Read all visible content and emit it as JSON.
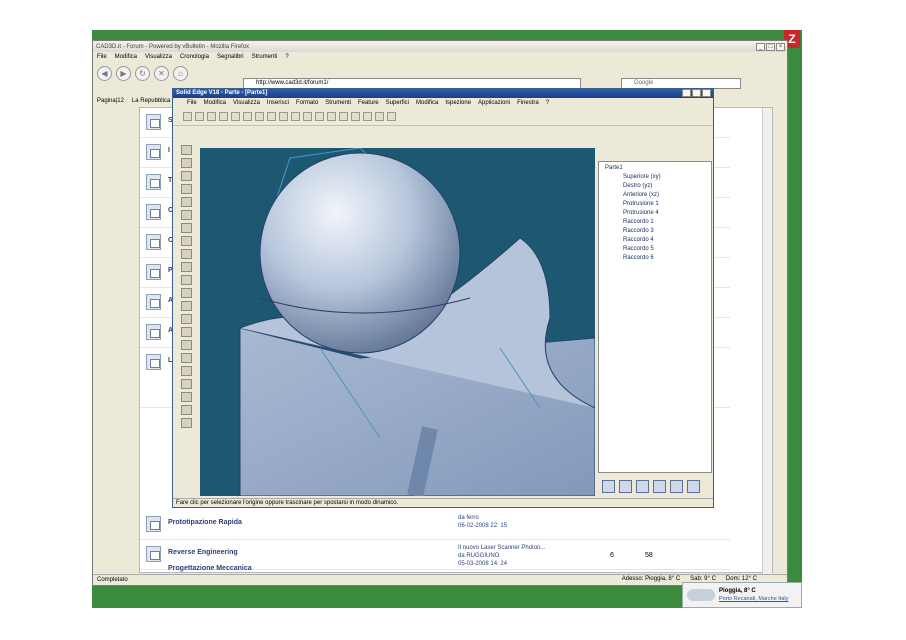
{
  "firefox": {
    "title": "CAD3D.it - Forum - Powered by vBulletin - Mozilla Firefox",
    "menu": [
      "File",
      "Modifica",
      "Visualizza",
      "Cronologia",
      "Segnalibri",
      "Strumenti",
      "?"
    ],
    "url": "http://www.cad3d.it/forum1/",
    "search_placeholder": "Google",
    "tabs": [
      "Pagina|12",
      "La Repubblica"
    ],
    "status_left": "Completato",
    "weather": [
      "Adesso: Pioggia, 8° C",
      "Sab: 9° C",
      "Dom: 12° C"
    ]
  },
  "forum": {
    "rows": [
      {
        "title": "S",
        "mid": "",
        "n1": "",
        "n2": ""
      },
      {
        "title": "I",
        "mid": "",
        "n1": "",
        "n2": ""
      },
      {
        "title": "T",
        "mid": "",
        "n1": "",
        "n2": ""
      },
      {
        "title": "C",
        "mid": "",
        "n1": "",
        "n2": ""
      },
      {
        "title": "C",
        "mid": "",
        "n1": "",
        "n2": ""
      },
      {
        "title": "P",
        "mid": "",
        "n1": "",
        "n2": ""
      },
      {
        "title": "A",
        "mid": "",
        "n1": "",
        "n2": ""
      },
      {
        "title": "A",
        "mid": "",
        "n1": "",
        "n2": ""
      },
      {
        "title": "L",
        "mid": "",
        "n1": "",
        "n2": ""
      },
      {
        "title": "Prototipazione Rapida",
        "mid": "da ferro\n06-02-2008 22: 15",
        "n1": "",
        "n2": ""
      },
      {
        "title": "Reverse Engineering",
        "mid": "Il nuovo Laser Scanner Photon...\nda RUGGIUNO\n05-03-2008 14: 24",
        "n1": "6",
        "n2": "58"
      },
      {
        "title": "Progettazione Meccanica",
        "mid": "",
        "n1": "",
        "n2": ""
      }
    ]
  },
  "solidedge": {
    "title": "Solid Edge V18 - Parte - [Parte1]",
    "menu": [
      "File",
      "Modifica",
      "Visualizza",
      "Inserisci",
      "Formato",
      "Strumenti",
      "Feature",
      "Superfici",
      "Modifica",
      "Ispezione",
      "Applicazioni",
      "Finestra",
      "?"
    ],
    "tree": [
      "Parte1",
      "Superiore (xy)",
      "Destro (yz)",
      "Anteriore (xz)",
      "Protrusione 1",
      "Protrusione 4",
      "Raccordo 1",
      "Raccordo 3",
      "Raccordo 4",
      "Raccordo 5",
      "Raccordo 6"
    ],
    "status": "Fare clic per selezionare l'origine oppure trascinare per spostarsi in modo dinamico."
  },
  "tooltip": {
    "line1": "Pioggia, 8° C",
    "line2": "Porto Recanati, Marche Italy"
  },
  "colors": {
    "viewport": "#1d5873",
    "desktop": "#3c8a3e",
    "se_title": "#2f5fb0"
  }
}
